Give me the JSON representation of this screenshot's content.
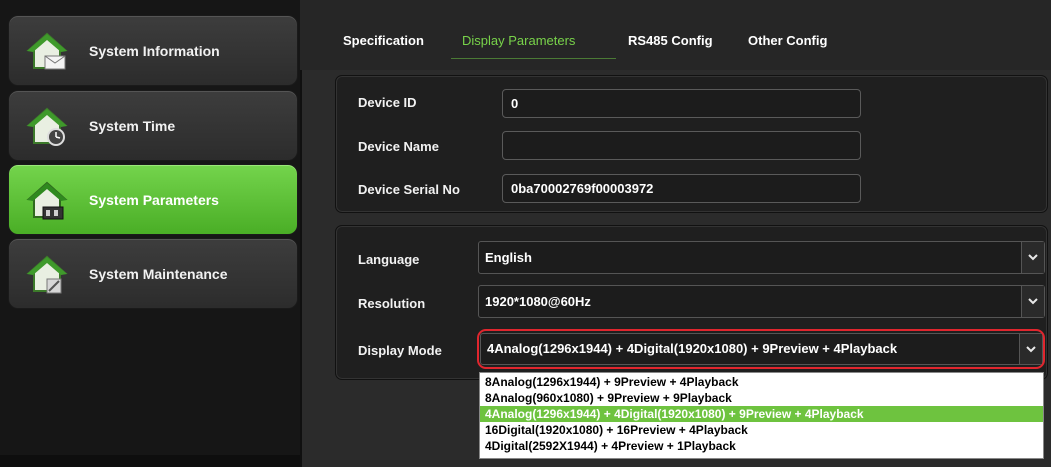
{
  "sidebar": {
    "items": [
      {
        "label": "System Information",
        "icon": "house-mail-icon",
        "active": false
      },
      {
        "label": "System Time",
        "icon": "house-clock-icon",
        "active": false
      },
      {
        "label": "System Parameters",
        "icon": "house-panel-icon",
        "active": true
      },
      {
        "label": "System Maintenance",
        "icon": "house-wrench-icon",
        "active": false
      }
    ]
  },
  "tabs": [
    {
      "label": "Specification",
      "active": false
    },
    {
      "label": "Display Parameters",
      "active": true
    },
    {
      "label": "RS485 Config",
      "active": false
    },
    {
      "label": "Other Config",
      "active": false
    }
  ],
  "device": {
    "id_label": "Device ID",
    "id_value": "0",
    "name_label": "Device Name",
    "name_value": "",
    "serial_label": "Device Serial No",
    "serial_value": "0ba70002769f00003972"
  },
  "display": {
    "language_label": "Language",
    "language_value": "English",
    "resolution_label": "Resolution",
    "resolution_value": "1920*1080@60Hz",
    "mode_label": "Display Mode",
    "mode_value": "4Analog(1296x1944) + 4Digital(1920x1080) + 9Preview + 4Playback",
    "mode_options": [
      "8Analog(1296x1944) + 9Preview + 4Playback",
      "8Analog(960x1080) + 9Preview + 9Playback",
      "4Analog(1296x1944) + 4Digital(1920x1080) + 9Preview + 4Playback",
      "16Digital(1920x1080) + 16Preview + 4Playback",
      "4Digital(2592X1944) + 4Preview + 1Playback"
    ],
    "mode_selected_index": 2
  },
  "colors": {
    "accent": "#6ec33f",
    "highlight_ring": "#e0262e",
    "active_tab": "#78d34a"
  }
}
